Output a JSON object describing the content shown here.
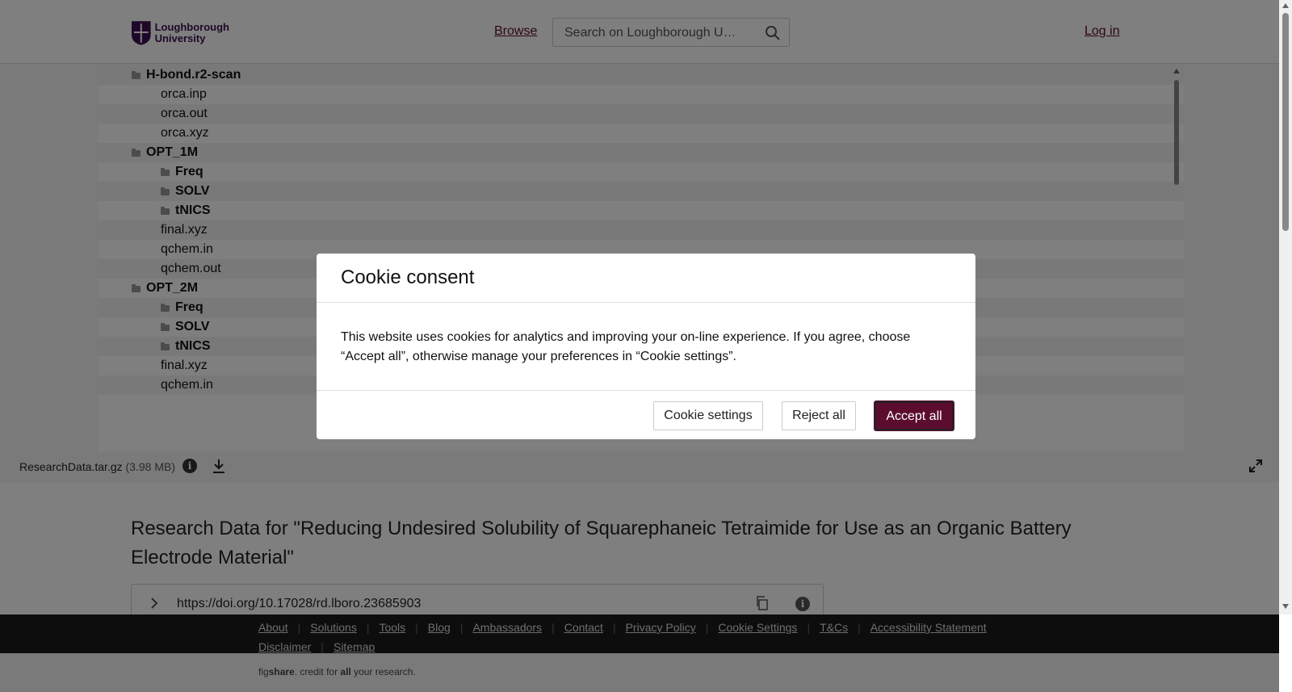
{
  "header": {
    "logo_line1": "Loughborough",
    "logo_line2": "University",
    "browse": "Browse",
    "search_placeholder": "Search on Loughborough U…",
    "login": "Log in"
  },
  "tree": [
    {
      "name": "H-bond.r2-scan",
      "dir": true,
      "level": 0
    },
    {
      "name": "orca.inp",
      "dir": false,
      "level": 1
    },
    {
      "name": "orca.out",
      "dir": false,
      "level": 1
    },
    {
      "name": "orca.xyz",
      "dir": false,
      "level": 1
    },
    {
      "name": "OPT_1M",
      "dir": true,
      "level": 0
    },
    {
      "name": "Freq",
      "dir": true,
      "level": 1
    },
    {
      "name": "SOLV",
      "dir": true,
      "level": 1
    },
    {
      "name": "tNICS",
      "dir": true,
      "level": 1
    },
    {
      "name": "final.xyz",
      "dir": false,
      "level": 1
    },
    {
      "name": "qchem.in",
      "dir": false,
      "level": 1
    },
    {
      "name": "qchem.out",
      "dir": false,
      "level": 1
    },
    {
      "name": "OPT_2M",
      "dir": true,
      "level": 0
    },
    {
      "name": "Freq",
      "dir": true,
      "level": 1
    },
    {
      "name": "SOLV",
      "dir": true,
      "level": 1
    },
    {
      "name": "tNICS",
      "dir": true,
      "level": 1
    },
    {
      "name": "final.xyz",
      "dir": false,
      "level": 1
    },
    {
      "name": "qchem.in",
      "dir": false,
      "level": 1
    }
  ],
  "file": {
    "name": "ResearchData.tar.gz",
    "size": "(3.98 MB)"
  },
  "title": "Research Data for \"Reducing Undesired Solubility of Squarephaneic Tetraimide for Use as an Organic Battery Electrode Material\"",
  "doi": "https://doi.org/10.17028/rd.lboro.23685903",
  "footer_links": [
    "About",
    "Solutions",
    "Tools",
    "Blog",
    "Ambassadors",
    "Contact",
    "Privacy Policy",
    "Cookie Settings",
    "T&Cs",
    "Accessibility Statement",
    "Disclaimer",
    "Sitemap"
  ],
  "footer_brand": {
    "pre": "fig",
    "bold1": "share",
    "mid": ". credit for ",
    "bold2": "all",
    "post": " your research."
  },
  "modal": {
    "title": "Cookie consent",
    "body": "This website uses cookies for analytics and improving your on-line experience. If you agree, choose “Accept all”, otherwise manage your preferences in “Cookie settings”.",
    "settings": "Cookie settings",
    "reject": "Reject all",
    "accept": "Accept all"
  },
  "colors": {
    "brand": "#5c0d2f",
    "logo": "#3d1152"
  }
}
